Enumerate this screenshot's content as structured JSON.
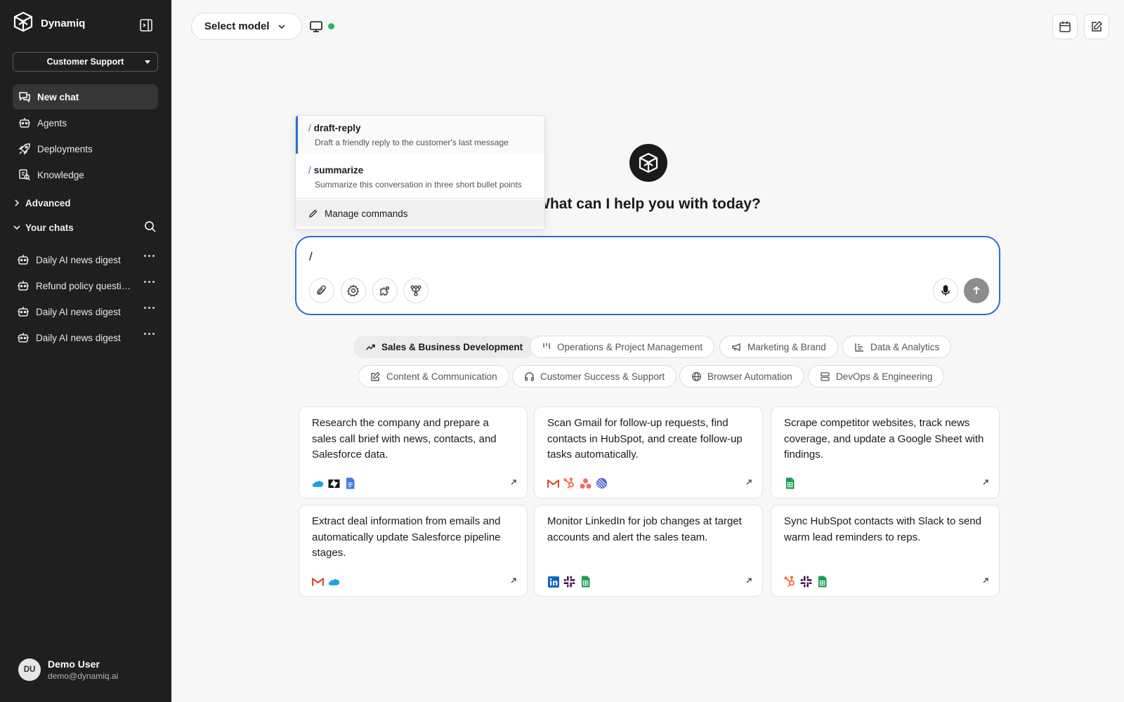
{
  "sidebar": {
    "brand": "Dynamiq",
    "workspace": "Customer Support",
    "nav": [
      {
        "label": "New chat"
      },
      {
        "label": "Agents"
      },
      {
        "label": "Deployments"
      },
      {
        "label": "Knowledge"
      }
    ],
    "advanced_label": "Advanced",
    "chats_label": "Your chats",
    "chats": [
      {
        "label": "Daily AI news digest"
      },
      {
        "label": "Refund policy question"
      },
      {
        "label": "Daily AI news digest"
      },
      {
        "label": "Daily AI news digest"
      }
    ],
    "user": {
      "initials": "DU",
      "name": "Demo User",
      "email": "demo@dynamiq.ai"
    }
  },
  "topbar": {
    "model_label": "Select model"
  },
  "hero": {
    "title": "What can I help you with today?"
  },
  "composer": {
    "value": "/"
  },
  "commands": [
    {
      "slash": "/",
      "name": "draft-reply",
      "description": "Draft a friendly reply to the customer's last message"
    },
    {
      "slash": "/",
      "name": "summarize",
      "description": "Summarize this conversation in three short bullet points"
    }
  ],
  "manage_commands": "Manage commands",
  "categories": [
    {
      "label": "Sales & Business Development",
      "icon": "trending-up-icon"
    },
    {
      "label": "Operations & Project Management",
      "icon": "bars-icon"
    },
    {
      "label": "Marketing & Brand",
      "icon": "megaphone-icon"
    },
    {
      "label": "Data & Analytics",
      "icon": "chart-icon"
    },
    {
      "label": "Content & Communication",
      "icon": "edit-icon"
    },
    {
      "label": "Customer Success & Support",
      "icon": "headphones-icon"
    },
    {
      "label": "Browser Automation",
      "icon": "globe-icon"
    },
    {
      "label": "DevOps & Engineering",
      "icon": "server-icon"
    }
  ],
  "cards": [
    {
      "text": "Research the company and prepare a sales call brief with news, contacts, and Salesforce data.",
      "icons": [
        "salesforce",
        "zendesk",
        "google-docs"
      ]
    },
    {
      "text": "Scan Gmail for follow-up requests, find contacts in HubSpot, and create follow-up tasks automatically.",
      "icons": [
        "gmail",
        "hubspot",
        "asana",
        "linear"
      ]
    },
    {
      "text": "Scrape competitor websites, track news coverage, and update a Google Sheet with findings.",
      "icons": [
        "google-sheets"
      ]
    },
    {
      "text": "Extract deal information from emails and automatically update Salesforce pipeline stages.",
      "icons": [
        "gmail",
        "salesforce"
      ]
    },
    {
      "text": "Monitor LinkedIn for job changes at target accounts and alert the sales team.",
      "icons": [
        "linkedin",
        "slack",
        "google-sheets"
      ]
    },
    {
      "text": "Sync HubSpot contacts with Slack to send warm lead reminders to reps.",
      "icons": [
        "hubspot",
        "slack",
        "google-sheets"
      ]
    }
  ],
  "colors": {
    "accent": "#2a6fd0",
    "sidebar": "#1f1f1f",
    "online": "#23b85a"
  }
}
